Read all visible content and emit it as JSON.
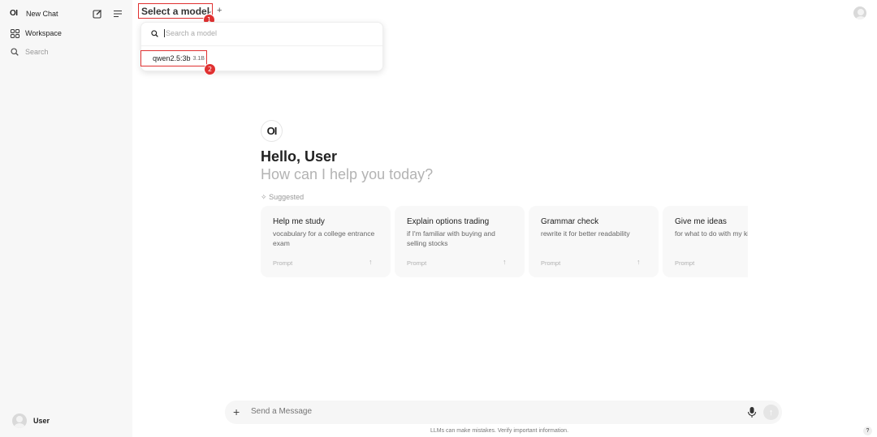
{
  "sidebar": {
    "logo": "OI",
    "new_chat": "New Chat",
    "workspace": "Workspace",
    "search": "Search",
    "user": "User"
  },
  "header": {
    "model_select": "Select a model",
    "badge1": "1",
    "badge2": "2"
  },
  "dropdown": {
    "search_placeholder": "Search a model",
    "items": [
      {
        "name": "qwen2.5:3b",
        "size": "3.1B"
      }
    ]
  },
  "main": {
    "logo": "OI",
    "greeting": "Hello, User",
    "subgreeting": "How can I help you today?",
    "suggested_label": "Suggested",
    "cards": [
      {
        "title": "Help me study",
        "subtitle": "vocabulary for a college entrance exam",
        "prompt": "Prompt"
      },
      {
        "title": "Explain options trading",
        "subtitle": "if I'm familiar with buying and selling stocks",
        "prompt": "Prompt"
      },
      {
        "title": "Grammar check",
        "subtitle": "rewrite it for better readability",
        "prompt": "Prompt"
      },
      {
        "title": "Give me ideas",
        "subtitle": "for what to do with my kids' art",
        "prompt": "Prompt"
      }
    ]
  },
  "input": {
    "placeholder": "Send a Message"
  },
  "footer": {
    "disclaimer": "LLMs can make mistakes. Verify important information.",
    "help": "?"
  }
}
